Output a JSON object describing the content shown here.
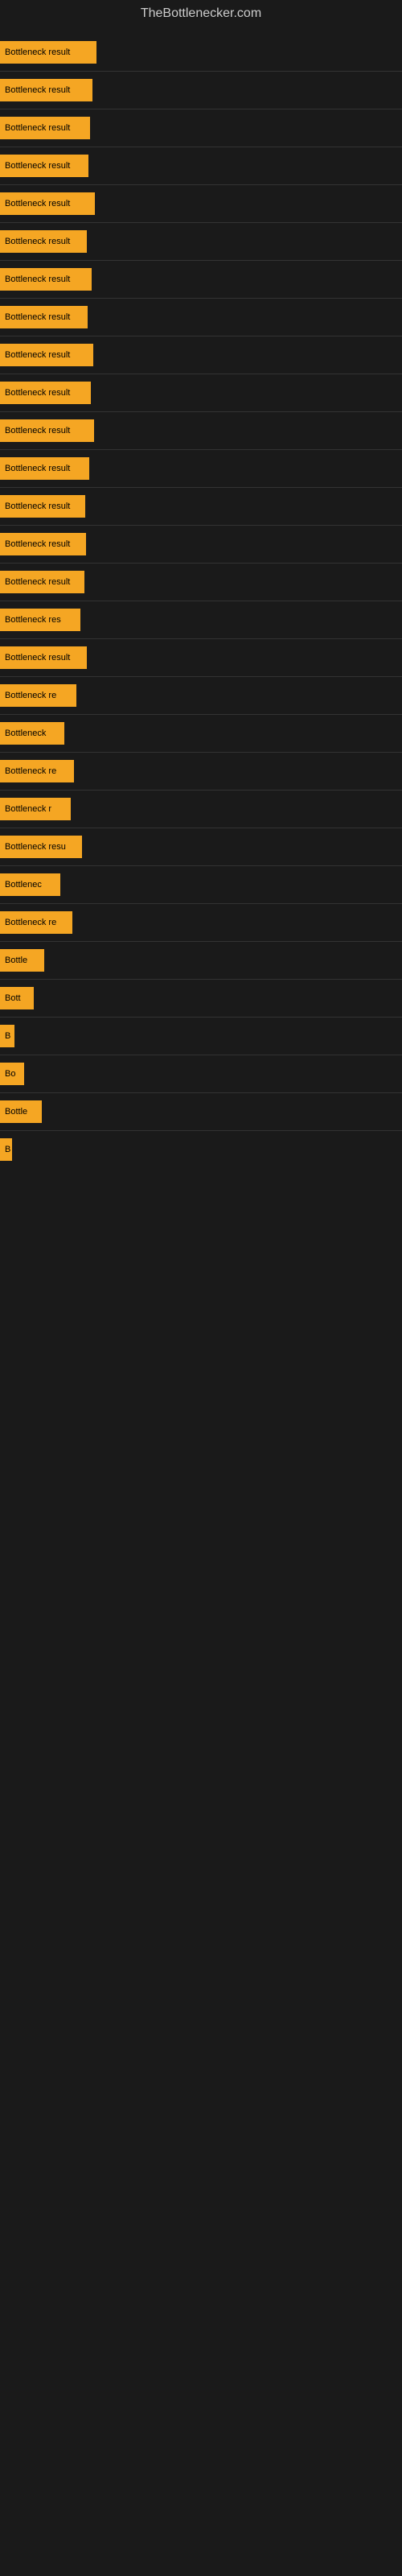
{
  "site": {
    "title": "TheBottlenecker.com"
  },
  "bars": [
    {
      "label": "Bottleneck result",
      "width": 120
    },
    {
      "label": "Bottleneck result",
      "width": 115
    },
    {
      "label": "Bottleneck result",
      "width": 112
    },
    {
      "label": "Bottleneck result",
      "width": 110
    },
    {
      "label": "Bottleneck result",
      "width": 118
    },
    {
      "label": "Bottleneck result",
      "width": 108
    },
    {
      "label": "Bottleneck result",
      "width": 114
    },
    {
      "label": "Bottleneck result",
      "width": 109
    },
    {
      "label": "Bottleneck result",
      "width": 116
    },
    {
      "label": "Bottleneck result",
      "width": 113
    },
    {
      "label": "Bottleneck result",
      "width": 117
    },
    {
      "label": "Bottleneck result",
      "width": 111
    },
    {
      "label": "Bottleneck result",
      "width": 106
    },
    {
      "label": "Bottleneck result",
      "width": 107
    },
    {
      "label": "Bottleneck result",
      "width": 105
    },
    {
      "label": "Bottleneck res",
      "width": 100
    },
    {
      "label": "Bottleneck result",
      "width": 108
    },
    {
      "label": "Bottleneck re",
      "width": 95
    },
    {
      "label": "Bottleneck",
      "width": 80
    },
    {
      "label": "Bottleneck re",
      "width": 92
    },
    {
      "label": "Bottleneck r",
      "width": 88
    },
    {
      "label": "Bottleneck resu",
      "width": 102
    },
    {
      "label": "Bottlenec",
      "width": 75
    },
    {
      "label": "Bottleneck re",
      "width": 90
    },
    {
      "label": "Bottle",
      "width": 55
    },
    {
      "label": "Bott",
      "width": 42
    },
    {
      "label": "B",
      "width": 18
    },
    {
      "label": "Bo",
      "width": 30
    },
    {
      "label": "Bottle",
      "width": 52
    },
    {
      "label": "B",
      "width": 15
    }
  ]
}
